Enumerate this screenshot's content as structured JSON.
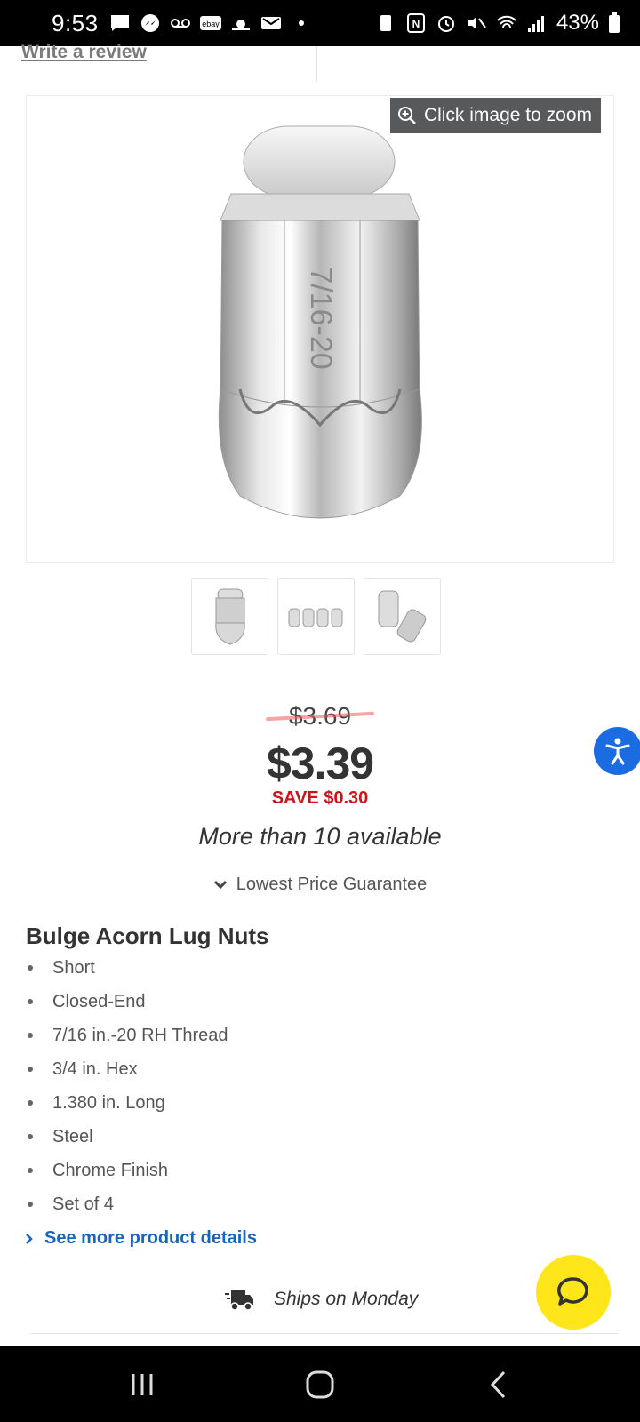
{
  "status_bar": {
    "time": "9:53",
    "battery": "43%"
  },
  "header": {
    "review_link": "Write a review"
  },
  "gallery": {
    "zoom_label": "Click image to zoom",
    "thumbnails": [
      "single-lug-nut",
      "set-of-four",
      "two-lug-nuts"
    ]
  },
  "pricing": {
    "old_price": "$3.69",
    "price": "$3.39",
    "save": "SAVE $0.30",
    "availability": "More than 10 available",
    "guarantee": "Lowest Price Guarantee"
  },
  "product": {
    "title": "Bulge Acorn Lug Nuts",
    "features": [
      "Short",
      "Closed-End",
      "7/16 in.-20 RH Thread",
      "3/4 in. Hex",
      "1.380 in. Long",
      "Steel",
      "Chrome Finish",
      "Set of 4"
    ],
    "see_more": "See more product details"
  },
  "shipping": {
    "text": "Ships on Monday"
  },
  "colors": {
    "accent_blue": "#1565c0",
    "sale_red": "#d0131a",
    "chat_yellow": "#ffe61a",
    "accessibility_blue": "#1a6ce0"
  }
}
